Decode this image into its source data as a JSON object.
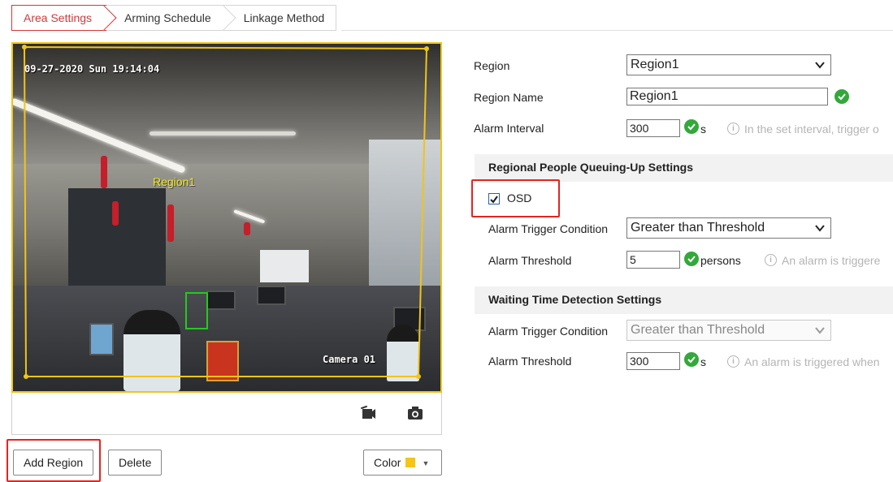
{
  "tabs": [
    {
      "label": "Area Settings",
      "active": true
    },
    {
      "label": "Arming Schedule",
      "active": false
    },
    {
      "label": "Linkage Method",
      "active": false
    }
  ],
  "video": {
    "osd_time": "09-27-2020 Sun 19:14:04",
    "osd_camera": "Camera 01",
    "region_label": "Region1",
    "record_icon": "video-camera-icon",
    "snapshot_icon": "camera-snapshot-icon"
  },
  "bottom_buttons": {
    "add_region": "Add Region",
    "delete": "Delete",
    "color": "Color",
    "color_value": "#f5c518"
  },
  "form": {
    "region": {
      "label": "Region",
      "value": "Region1"
    },
    "region_name": {
      "label": "Region Name",
      "value": "Region1"
    },
    "alarm_interval": {
      "label": "Alarm Interval",
      "value": "300",
      "unit": "s",
      "hint": "In the set interval, trigger o"
    }
  },
  "queuing_section": {
    "title": "Regional People Queuing-Up Settings",
    "osd": {
      "label": "OSD",
      "checked": true
    },
    "trigger_condition": {
      "label": "Alarm Trigger Condition",
      "value": "Greater than Threshold"
    },
    "threshold": {
      "label": "Alarm Threshold",
      "value": "5",
      "unit": "persons",
      "hint": "An alarm is triggere"
    }
  },
  "waiting_section": {
    "title": "Waiting Time Detection Settings",
    "trigger_condition": {
      "label": "Alarm Trigger Condition",
      "value": "Greater than Threshold",
      "disabled": true
    },
    "threshold": {
      "label": "Alarm Threshold",
      "value": "300",
      "unit": "s",
      "hint": "An alarm is triggered when"
    }
  },
  "colors": {
    "accent_red": "#d6373a",
    "valid_green": "#34a83b",
    "region_yellow": "#f0c419",
    "detect_green": "#27c81f"
  }
}
